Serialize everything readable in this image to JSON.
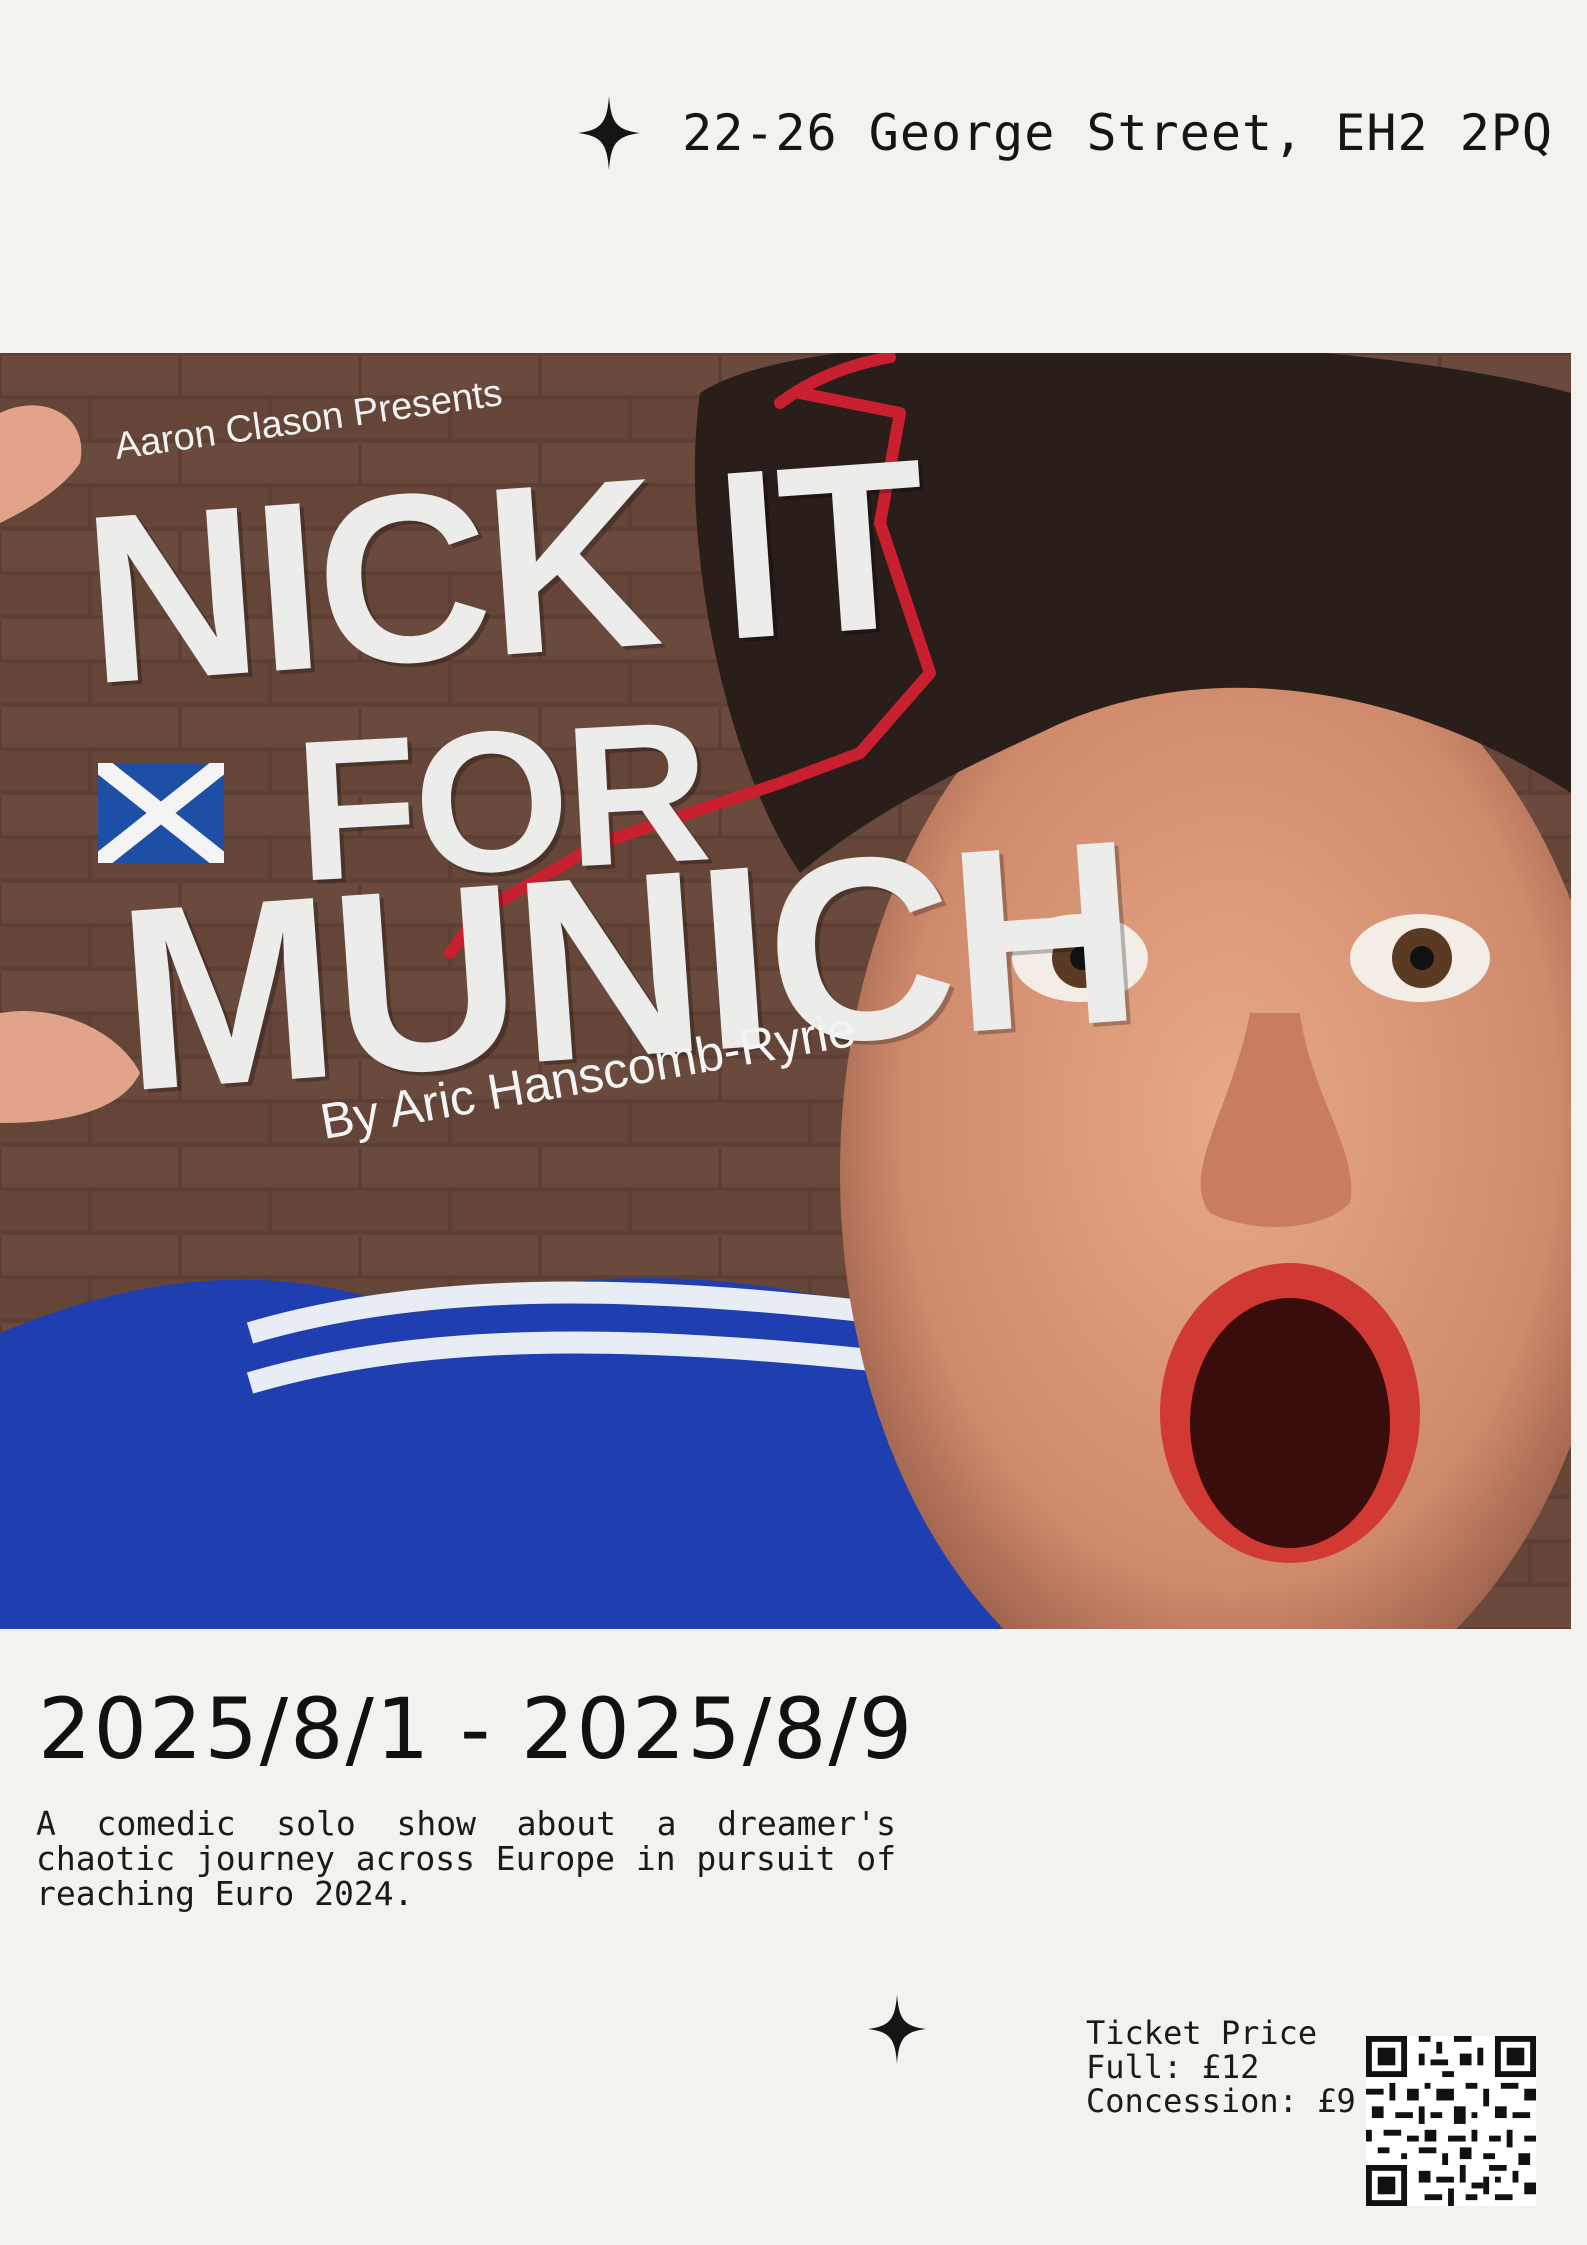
{
  "header": {
    "address": "22-26 George Street, EH2 2PQ",
    "icon": "sparkle-icon"
  },
  "poster": {
    "presents": "Aaron Clason Presents",
    "title_line1": "NICK IT",
    "title_line2": "FOR",
    "title_line3": "MUNICH",
    "byline": "By Aric Hanscomb-Ryrie",
    "flag_icon": "scotland-flag-icon"
  },
  "event": {
    "dates": "2025/8/1 - 2025/8/9",
    "description": "A comedic solo show about a dreamer's chaotic journey across Europe in pursuit of reaching Euro 2024."
  },
  "tickets": {
    "heading": "Ticket Price",
    "full": "Full: £12",
    "concession": "Concession: £9",
    "qr_icon": "qr-code-icon"
  },
  "colors": {
    "background": "#f3f2ee",
    "accent_red": "#c8202e",
    "jersey_blue": "#1f3fb0",
    "title_white": "#ececea"
  }
}
